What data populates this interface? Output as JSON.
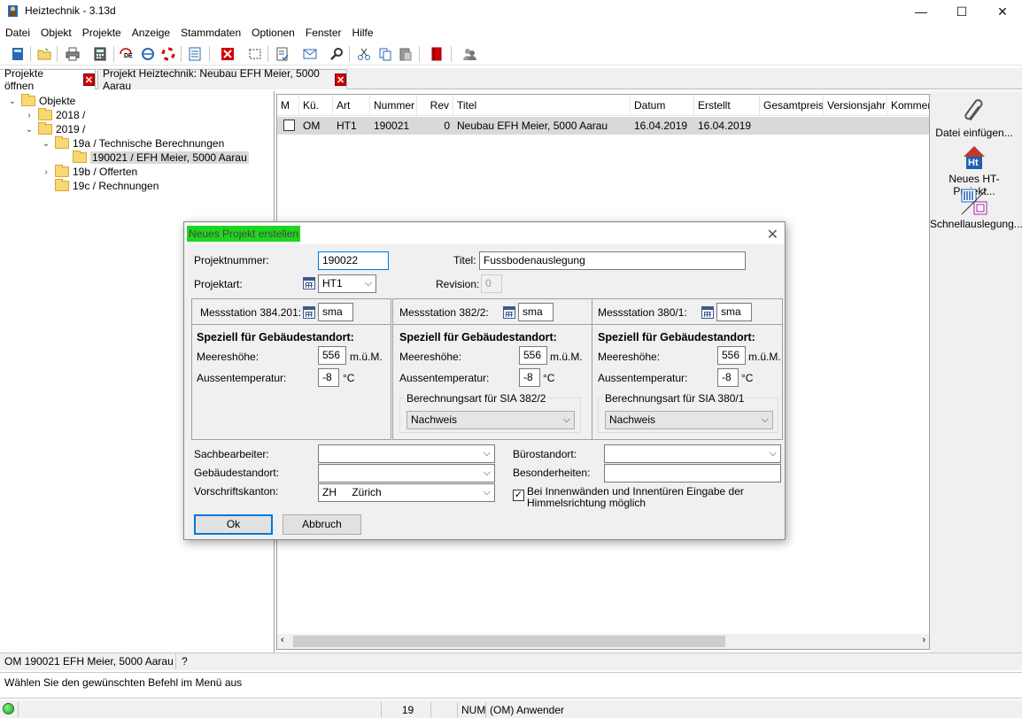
{
  "window": {
    "title": "Heiztechnik - 3.13d",
    "controls": {
      "minimize": "—",
      "maximize": "☐",
      "close": "✕"
    }
  },
  "menu": [
    "Datei",
    "Objekt",
    "Projekte",
    "Anzeige",
    "Stammdaten",
    "Optionen",
    "Fenster",
    "Hilfe"
  ],
  "tabs": [
    {
      "label": "Projekte öffnen"
    },
    {
      "label": "Projekt Heiztechnik: Neubau EFH Meier, 5000 Aarau"
    }
  ],
  "tree": {
    "root": "Objekte",
    "items": [
      "2018 /",
      "2019 /",
      "19a / Technische Berechnungen",
      "190021 / EFH Meier, 5000 Aarau",
      "19b / Offerten",
      "19c / Rechnungen"
    ]
  },
  "list": {
    "columns": [
      "M",
      "Kü.",
      "Art",
      "Nummer",
      "Rev",
      "Titel",
      "Datum",
      "Erstellt",
      "Gesamtpreis",
      "Versionsjahr",
      "Komment"
    ],
    "row": {
      "kue": "OM",
      "art": "HT1",
      "nummer": "190021",
      "rev": "0",
      "titel": "Neubau EFH Meier, 5000 Aarau",
      "datum": "16.04.2019",
      "erstellt": "16.04.2019"
    }
  },
  "sidebar": {
    "file_insert": "Datei einfügen...",
    "new_project": "Neues HT-Projekt...",
    "quick_design": "Schnellauslegung...",
    "ht_badge": "Ht"
  },
  "dialog": {
    "title": "Neues Projekt erstellen",
    "projektnummer_label": "Projektnummer:",
    "projektnummer_value": "190022",
    "titel_label": "Titel:",
    "titel_value": "Fussbodenauslegung",
    "projektart_label": "Projektart:",
    "projektart_value": "HT1",
    "revision_label": "Revision:",
    "revision_value": "0",
    "stations": [
      {
        "label": "Messstation 384.201:",
        "code": "sma",
        "heading": "Speziell für Gebäudestandort:",
        "height_label": "Meereshöhe:",
        "height_value": "556",
        "height_unit": "m.ü.M.",
        "temp_label": "Aussentemperatur:",
        "temp_value": "-8",
        "temp_unit": "°C"
      },
      {
        "label": "Messstation 382/2:",
        "code": "sma",
        "heading": "Speziell für Gebäudestandort:",
        "height_label": "Meereshöhe:",
        "height_value": "556",
        "height_unit": "m.ü.M.",
        "temp_label": "Aussentemperatur:",
        "temp_value": "-8",
        "temp_unit": "°C",
        "calc_label": "Berechnungsart für SIA 382/2",
        "calc_value": "Nachweis"
      },
      {
        "label": "Messstation 380/1:",
        "code": "sma",
        "heading": "Speziell für Gebäudestandort:",
        "height_label": "Meereshöhe:",
        "height_value": "556",
        "height_unit": "m.ü.M.",
        "temp_label": "Aussentemperatur:",
        "temp_value": "-8",
        "temp_unit": "°C",
        "calc_label": "Berechnungsart für SIA 380/1",
        "calc_value": "Nachweis"
      }
    ],
    "sachbearbeiter_label": "Sachbearbeiter:",
    "sachbearbeiter_value": "",
    "gebaeudestandort_label": "Gebäudestandort:",
    "gebaeudestandort_value": "",
    "vorschriftskanton_label": "Vorschriftskanton:",
    "vorschriftskanton_code": "ZH",
    "vorschriftskanton_name": "Zürich",
    "buerostandort_label": "Bürostandort:",
    "buerostandort_value": "",
    "besonderheiten_label": "Besonderheiten:",
    "besonderheiten_value": "",
    "checkbox_label_1": "Bei Innenwänden und Innentüren Eingabe der",
    "checkbox_label_2": "Himmelsrichtung möglich",
    "checkbox_checked": true,
    "ok_label": "Ok",
    "cancel_label": "Abbruch"
  },
  "info_bar": {
    "project": "OM 190021 EFH Meier, 5000 Aarau",
    "help": "?"
  },
  "message": "Wählen Sie den gewünschten Befehl im Menü aus",
  "status_bar": {
    "count": "19",
    "num": "NUM",
    "user": "(OM) Anwender"
  },
  "colors": {
    "dialog_title_highlight": "#1fd61f",
    "selection": "#d9d9d9",
    "close_tab": "#d40000"
  }
}
